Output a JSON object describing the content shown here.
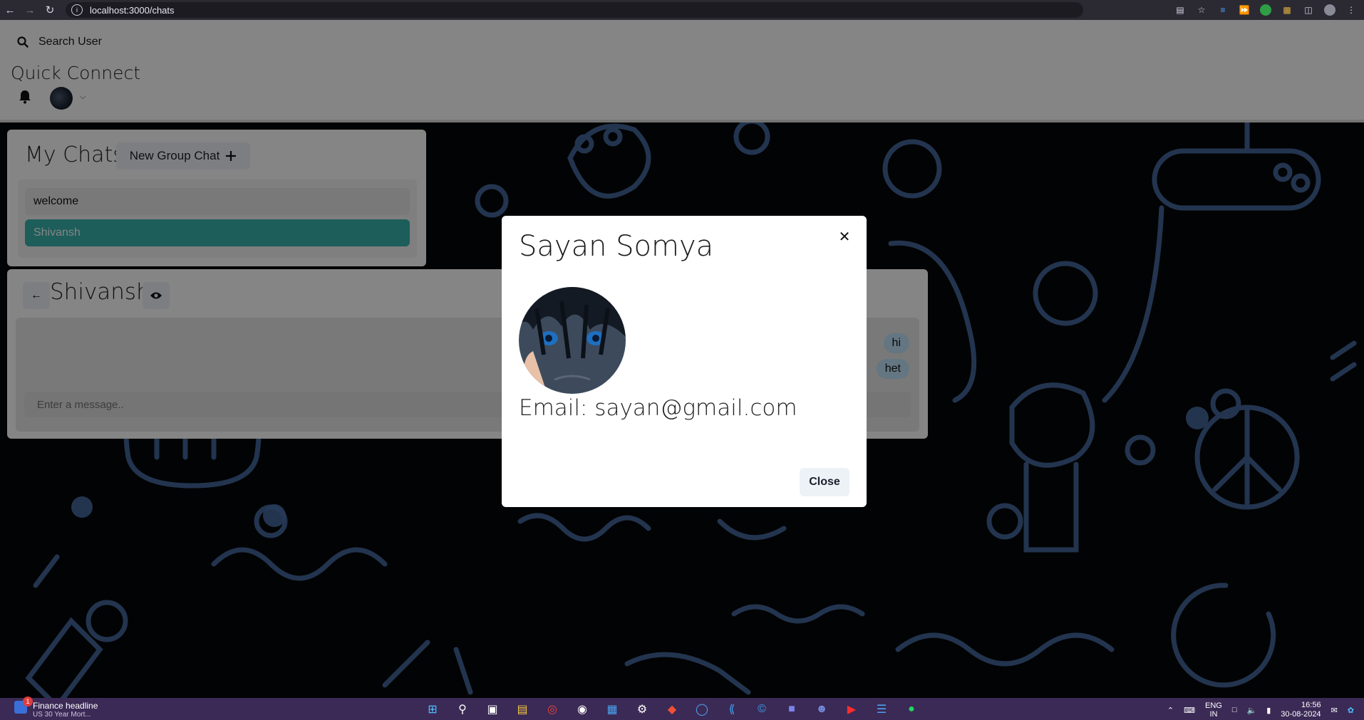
{
  "browser": {
    "url": "localhost:3000/chats"
  },
  "header": {
    "search_label": "Search User",
    "brand": "Quick Connect"
  },
  "my_chats": {
    "title": "My Chats",
    "new_group_label": "New Group Chat",
    "chats": [
      {
        "name": "welcome",
        "active": false
      },
      {
        "name": "Shivansh",
        "active": true
      }
    ]
  },
  "chat_box": {
    "title": "Shivansh",
    "messages": [
      {
        "text": "hi",
        "from": "self"
      },
      {
        "text": "het",
        "from": "self"
      }
    ],
    "input_placeholder": "Enter a message.."
  },
  "modal": {
    "title": "Sayan Somya",
    "email_text": "Email: sayan@gmail.com",
    "close_label": "Close"
  },
  "taskbar": {
    "news_title": "Finance headline",
    "news_sub": "US 30 Year Mort...",
    "notif_count": "1",
    "lang_line1": "ENG",
    "lang_line2": "IN",
    "time": "16:56",
    "date": "30-08-2024"
  },
  "colors": {
    "accent_active": "#38b2ac",
    "bubble": "#bee3f8",
    "taskbar": "#3b2a56"
  }
}
